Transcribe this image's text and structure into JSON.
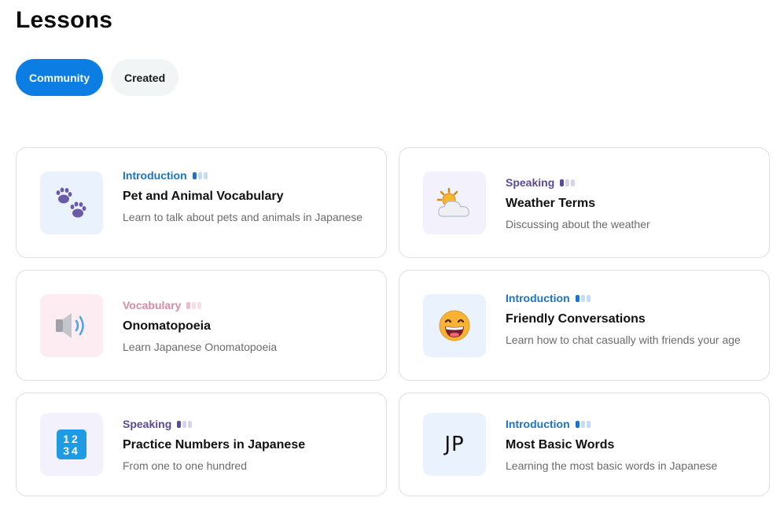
{
  "page": {
    "title": "Lessons"
  },
  "tabs": [
    {
      "label": "Community",
      "active": true
    },
    {
      "label": "Created",
      "active": false
    }
  ],
  "lessons": [
    {
      "category": "Introduction",
      "level": 1,
      "title": "Pet and Animal Vocabulary",
      "description": "Learn to talk about pets and animals in Japanese",
      "icon": "paw-prints-icon"
    },
    {
      "category": "Speaking",
      "level": 1,
      "title": "Weather Terms",
      "description": "Discussing about the weather",
      "icon": "sun-behind-cloud-icon"
    },
    {
      "category": "Vocabulary",
      "level": 1,
      "title": "Onomatopoeia",
      "description": "Learn Japanese Onomatopoeia",
      "icon": "speaker-icon"
    },
    {
      "category": "Introduction",
      "level": 1,
      "title": "Friendly Conversations",
      "description": "Learn how to chat casually with friends your age",
      "icon": "grinning-face-icon"
    },
    {
      "category": "Speaking",
      "level": 1,
      "title": "Practice Numbers in Japanese",
      "description": "From one to one hundred",
      "icon": "numbers-1234-icon",
      "icon_text": "1234"
    },
    {
      "category": "Introduction",
      "level": 1,
      "title": "Most Basic Words",
      "description": "Learning the most basic words in Japanese",
      "icon": "jp-text-icon",
      "icon_text": "JP"
    }
  ],
  "colors": {
    "primary": "#0b7de3",
    "introduction": "#1b74c8",
    "speaking": "#5b4a96",
    "vocabulary": "#d68aa4"
  }
}
